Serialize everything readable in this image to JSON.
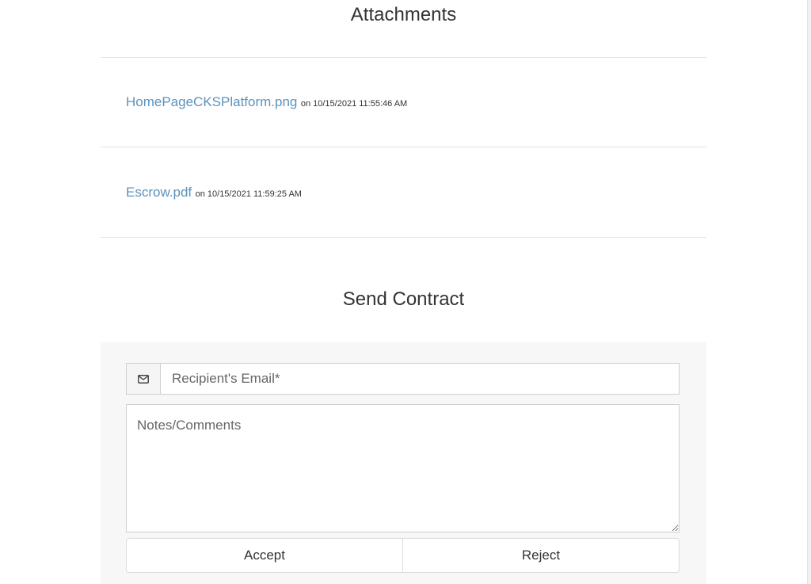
{
  "attachments": {
    "title": "Attachments",
    "items": [
      {
        "name": "HomePageCKSPlatform.png",
        "meta": "on 10/15/2021 11:55:46 AM"
      },
      {
        "name": "Escrow.pdf",
        "meta": "on 10/15/2021 11:59:25 AM"
      }
    ]
  },
  "send_contract": {
    "title": "Send Contract",
    "email_icon": "envelope-icon",
    "email_placeholder": "Recipient's Email*",
    "email_value": "",
    "notes_placeholder": "Notes/Comments",
    "notes_value": "",
    "accept_label": "Accept",
    "reject_label": "Reject"
  },
  "colors": {
    "link": "#5b93bd",
    "panel_bg": "#f7f7f7",
    "rule": "#e3e3e3"
  }
}
